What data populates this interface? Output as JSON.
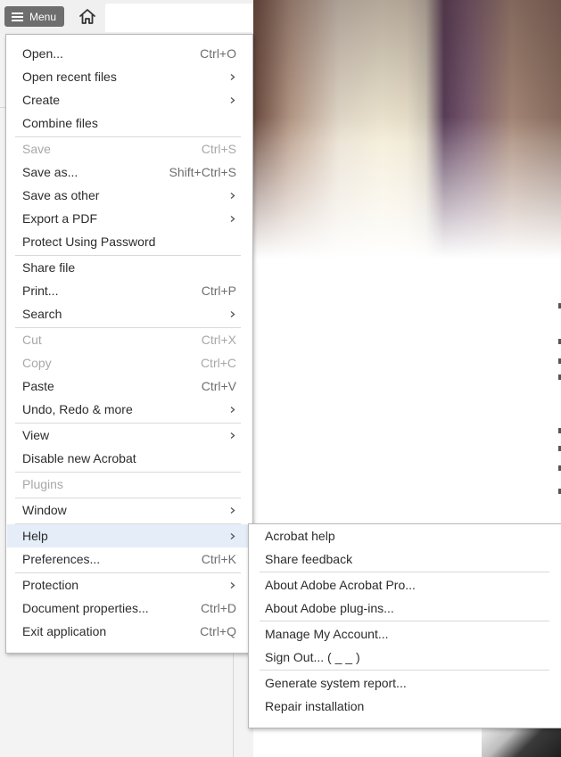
{
  "toolbar": {
    "menu_label": "Menu"
  },
  "main_menu": {
    "items": [
      {
        "label": "Open...",
        "shortcut": "Ctrl+O"
      },
      {
        "label": "Open recent files",
        "submenu": true
      },
      {
        "label": "Create",
        "submenu": true
      },
      {
        "label": "Combine files"
      },
      {
        "label": "Save",
        "shortcut": "Ctrl+S",
        "disabled": true
      },
      {
        "label": "Save as...",
        "shortcut": "Shift+Ctrl+S"
      },
      {
        "label": "Save as other",
        "submenu": true
      },
      {
        "label": "Export a PDF",
        "submenu": true
      },
      {
        "label": "Protect Using Password"
      },
      {
        "label": "Share file"
      },
      {
        "label": "Print...",
        "shortcut": "Ctrl+P"
      },
      {
        "label": "Search",
        "submenu": true
      },
      {
        "label": "Cut",
        "shortcut": "Ctrl+X",
        "disabled": true
      },
      {
        "label": "Copy",
        "shortcut": "Ctrl+C",
        "disabled": true
      },
      {
        "label": "Paste",
        "shortcut": "Ctrl+V"
      },
      {
        "label": "Undo, Redo & more",
        "submenu": true
      },
      {
        "label": "View",
        "submenu": true
      },
      {
        "label": "Disable new Acrobat"
      },
      {
        "label": "Plugins",
        "disabled": true
      },
      {
        "label": "Window",
        "submenu": true
      },
      {
        "label": "Help",
        "submenu": true,
        "highlighted": true
      },
      {
        "label": "Preferences...",
        "shortcut": "Ctrl+K"
      },
      {
        "label": "Protection",
        "submenu": true
      },
      {
        "label": "Document properties...",
        "shortcut": "Ctrl+D"
      },
      {
        "label": "Exit application",
        "shortcut": "Ctrl+Q"
      }
    ]
  },
  "help_submenu": {
    "items": [
      {
        "label": "Acrobat help"
      },
      {
        "label": "Share feedback"
      },
      {
        "label": "About Adobe Acrobat Pro..."
      },
      {
        "label": "About Adobe plug-ins..."
      },
      {
        "label": "Manage My Account..."
      },
      {
        "label": "Sign Out... (                    _                    _           )"
      },
      {
        "label": "Generate system report..."
      },
      {
        "label": "Repair installation"
      }
    ]
  },
  "colors": {
    "highlight": "#e4edf8",
    "menu_button": "#6e6e6e",
    "disabled_text": "#a8a8a8"
  },
  "icons": {
    "menu": "hamburger-icon",
    "home": "home-icon",
    "submenu": "chevron-right-icon"
  }
}
